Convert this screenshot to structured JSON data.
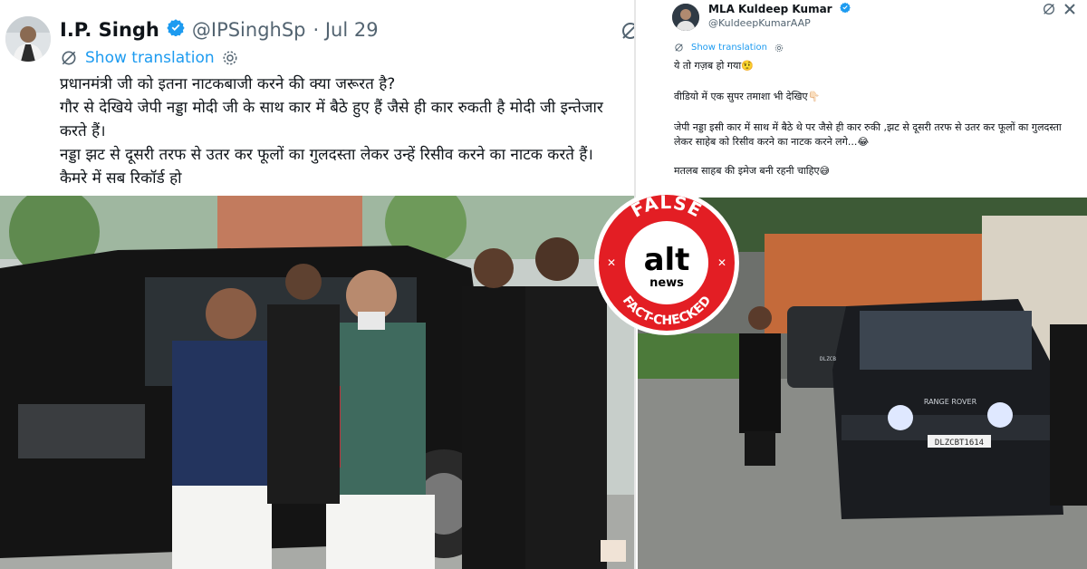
{
  "left_tweet": {
    "display_name": "I.P. Singh",
    "handle": "@IPSinghSp",
    "date": "· Jul 29",
    "translate_label": "Show translation",
    "text": "प्रधानमंत्री जी को इतना नाटकबाजी करने की क्या जरूरत है?\nगौर से देखिये जेपी नड्डा मोदी जी के साथ कार में बैठे हुए हैं जैसे ही कार रुकती है मोदी जी इन्तेजार करते हैं।\nनड्डा झट से दूसरी तरफ से उतर कर फूलों का गुलदस्ता लेकर उन्हें रिसीव करने का नाटक करते हैं।\nकैमरे में सब रिकॉर्ड हो"
  },
  "right_tweet": {
    "display_name": "MLA Kuldeep Kumar",
    "handle": "@KuldeepKumarAAP",
    "translate_label": "Show translation",
    "line1": "ये तो गज़ब हो गया🤨",
    "line2": "वीडियो में एक सुपर तमाशा भी देखिए👇🏻",
    "line3": "जेपी नड्डा इसी कार में साथ में बैठे थे पर जैसे ही कार रुकी ,झट से दूसरी तरफ से उतर कर फूलों का गुलदस्ता लेकर साहेब को रिसीव करने का नाटक करने लगे...😂",
    "line4": "मतलब साहब की इमेज बनी रहनी चाहिए😅"
  },
  "badge": {
    "top_text": "FALSE",
    "logo_text": "alt",
    "logo_sub": "news",
    "bottom_text": "FACT-CHECKED"
  },
  "right_photo": {
    "car_brand": "RANGE ROVER",
    "plate": "DLZCBT1614",
    "side_plate": "DLZCB"
  },
  "colors": {
    "accent_blue": "#1d9bf0",
    "badge_red": "#e31e24",
    "verified_blue": "#1d9bf0"
  }
}
